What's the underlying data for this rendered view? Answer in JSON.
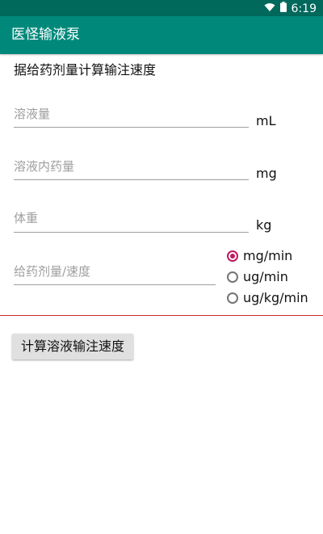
{
  "status_bar": {
    "time": "6:19"
  },
  "app_bar": {
    "title": "医怪输液泵"
  },
  "main": {
    "section_title": "据给药剂量计算输注速度",
    "fields": [
      {
        "hint": "溶液量",
        "unit": "mL",
        "value": ""
      },
      {
        "hint": "溶液内药量",
        "unit": "mg",
        "value": ""
      },
      {
        "hint": "体重",
        "unit": "kg",
        "value": ""
      },
      {
        "hint": "给药剂量/速度",
        "value": ""
      }
    ],
    "rate_unit_options": [
      {
        "label": "mg/min",
        "checked": true
      },
      {
        "label": "ug/min",
        "checked": false
      },
      {
        "label": "ug/kg/min",
        "checked": false
      }
    ],
    "calculate_button_label": "计算溶液输注速度"
  },
  "colors": {
    "status_bar": "#00695c",
    "app_bar": "#00897b",
    "radio_accent": "#c2185b",
    "divider": "#c62828"
  }
}
